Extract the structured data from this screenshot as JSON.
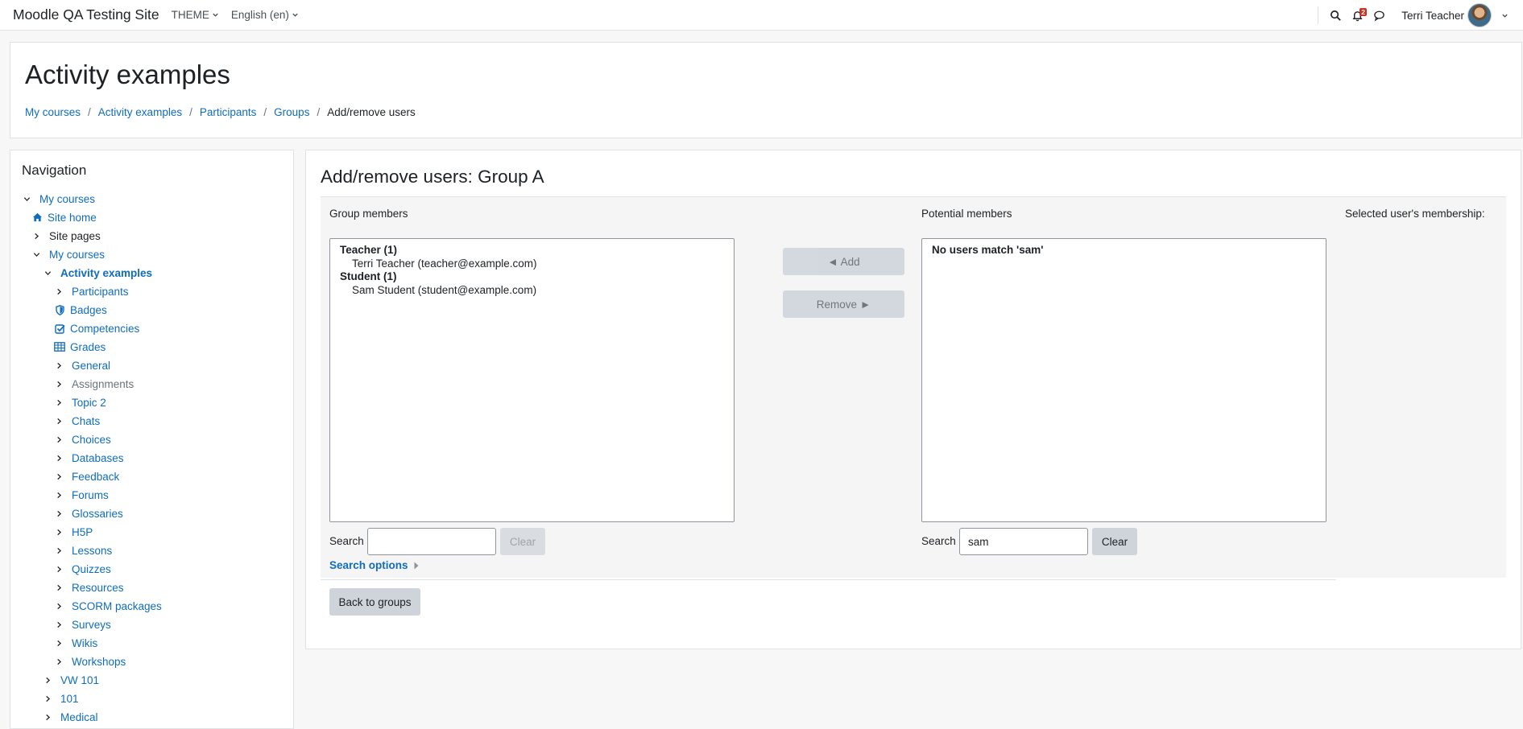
{
  "navbar": {
    "site_name": "Moodle QA Testing Site",
    "theme_label": "THEME",
    "language_label": "English (en)",
    "notification_count": "2",
    "user_name": "Terri Teacher"
  },
  "header": {
    "title": "Activity examples",
    "breadcrumb": [
      "My courses",
      "Activity examples",
      "Participants",
      "Groups",
      "Add/remove users"
    ]
  },
  "navigation": {
    "title": "Navigation",
    "items": [
      {
        "label": "My courses",
        "icon": "chevron-down-icon"
      },
      {
        "label": "Site home",
        "icon": "home-icon"
      },
      {
        "label": "Site pages",
        "icon": "chevron-right-icon"
      },
      {
        "label": "My courses",
        "icon": "chevron-down-icon"
      },
      {
        "label": "Activity examples",
        "icon": "chevron-down-icon"
      },
      {
        "label": "Participants",
        "icon": "chevron-right-icon"
      },
      {
        "label": "Badges",
        "icon": "shield-icon"
      },
      {
        "label": "Competencies",
        "icon": "check-square-icon"
      },
      {
        "label": "Grades",
        "icon": "table-icon"
      },
      {
        "label": "General",
        "icon": "chevron-right-icon"
      },
      {
        "label": "Assignments",
        "icon": "chevron-right-icon"
      },
      {
        "label": "Topic 2",
        "icon": "chevron-right-icon"
      },
      {
        "label": "Chats",
        "icon": "chevron-right-icon"
      },
      {
        "label": "Choices",
        "icon": "chevron-right-icon"
      },
      {
        "label": "Databases",
        "icon": "chevron-right-icon"
      },
      {
        "label": "Feedback",
        "icon": "chevron-right-icon"
      },
      {
        "label": "Forums",
        "icon": "chevron-right-icon"
      },
      {
        "label": "Glossaries",
        "icon": "chevron-right-icon"
      },
      {
        "label": "H5P",
        "icon": "chevron-right-icon"
      },
      {
        "label": "Lessons",
        "icon": "chevron-right-icon"
      },
      {
        "label": "Quizzes",
        "icon": "chevron-right-icon"
      },
      {
        "label": "Resources",
        "icon": "chevron-right-icon"
      },
      {
        "label": "SCORM packages",
        "icon": "chevron-right-icon"
      },
      {
        "label": "Surveys",
        "icon": "chevron-right-icon"
      },
      {
        "label": "Wikis",
        "icon": "chevron-right-icon"
      },
      {
        "label": "Workshops",
        "icon": "chevron-right-icon"
      },
      {
        "label": "VW 101",
        "icon": "chevron-right-icon"
      },
      {
        "label": "101",
        "icon": "chevron-right-icon"
      },
      {
        "label": "Medical",
        "icon": "chevron-right-icon"
      }
    ]
  },
  "main": {
    "title": "Add/remove users: Group A",
    "group_members_label": "Group members",
    "potential_members_label": "Potential members",
    "membership_label": "Selected user's membership:",
    "group_members": [
      {
        "group": "Teacher (1)",
        "options": [
          "Terri Teacher (teacher@example.com)"
        ]
      },
      {
        "group": "Student (1)",
        "options": [
          "Sam Student (student@example.com)"
        ]
      }
    ],
    "potential_members_message": "No users match 'sam'",
    "add_label": "◄ Add",
    "remove_label": "Remove ►",
    "search_label": "Search",
    "left_search_value": "",
    "right_search_value": "sam",
    "clear_label": "Clear",
    "search_options_label": "Search options",
    "back_label": "Back to groups"
  }
}
